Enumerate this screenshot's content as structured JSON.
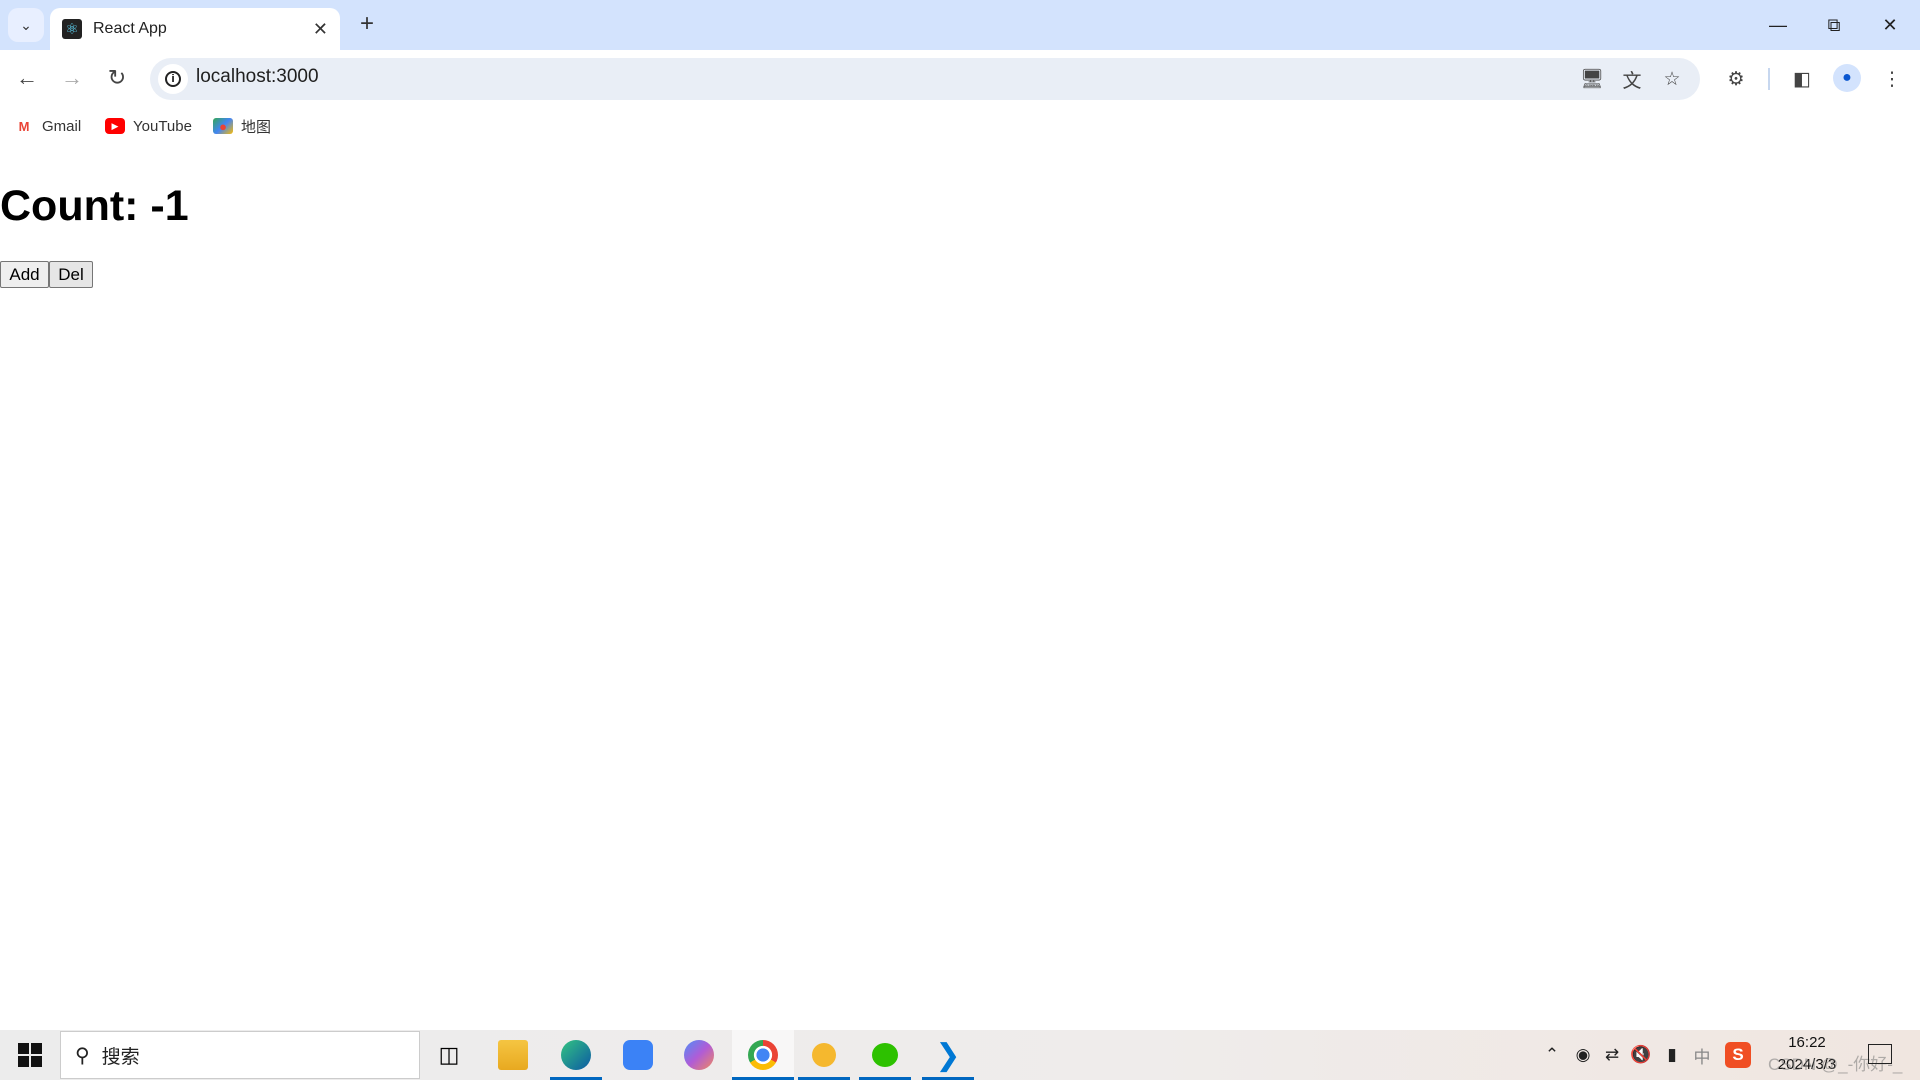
{
  "browser": {
    "tab": {
      "title": "React App",
      "favicon": "react-logo-icon"
    },
    "new_tab": "+",
    "url": "localhost:3000",
    "bookmarks": [
      {
        "label": "Gmail",
        "icon": "gmail-icon"
      },
      {
        "label": "YouTube",
        "icon": "youtube-icon"
      },
      {
        "label": "地图",
        "icon": "maps-icon"
      }
    ]
  },
  "page": {
    "heading": "Count: -1",
    "buttons": {
      "add": "Add",
      "del": "Del"
    }
  },
  "taskbar": {
    "search_placeholder": "搜索",
    "clock": {
      "time": "16:22",
      "date": "2024/3/3"
    },
    "ime": "中",
    "watermark": "CSDN @_-你好-_"
  },
  "colors": {
    "tabbar": "#d3e3fd",
    "omnibox": "#e9eef6",
    "taskbar_active": "#0067c0"
  }
}
